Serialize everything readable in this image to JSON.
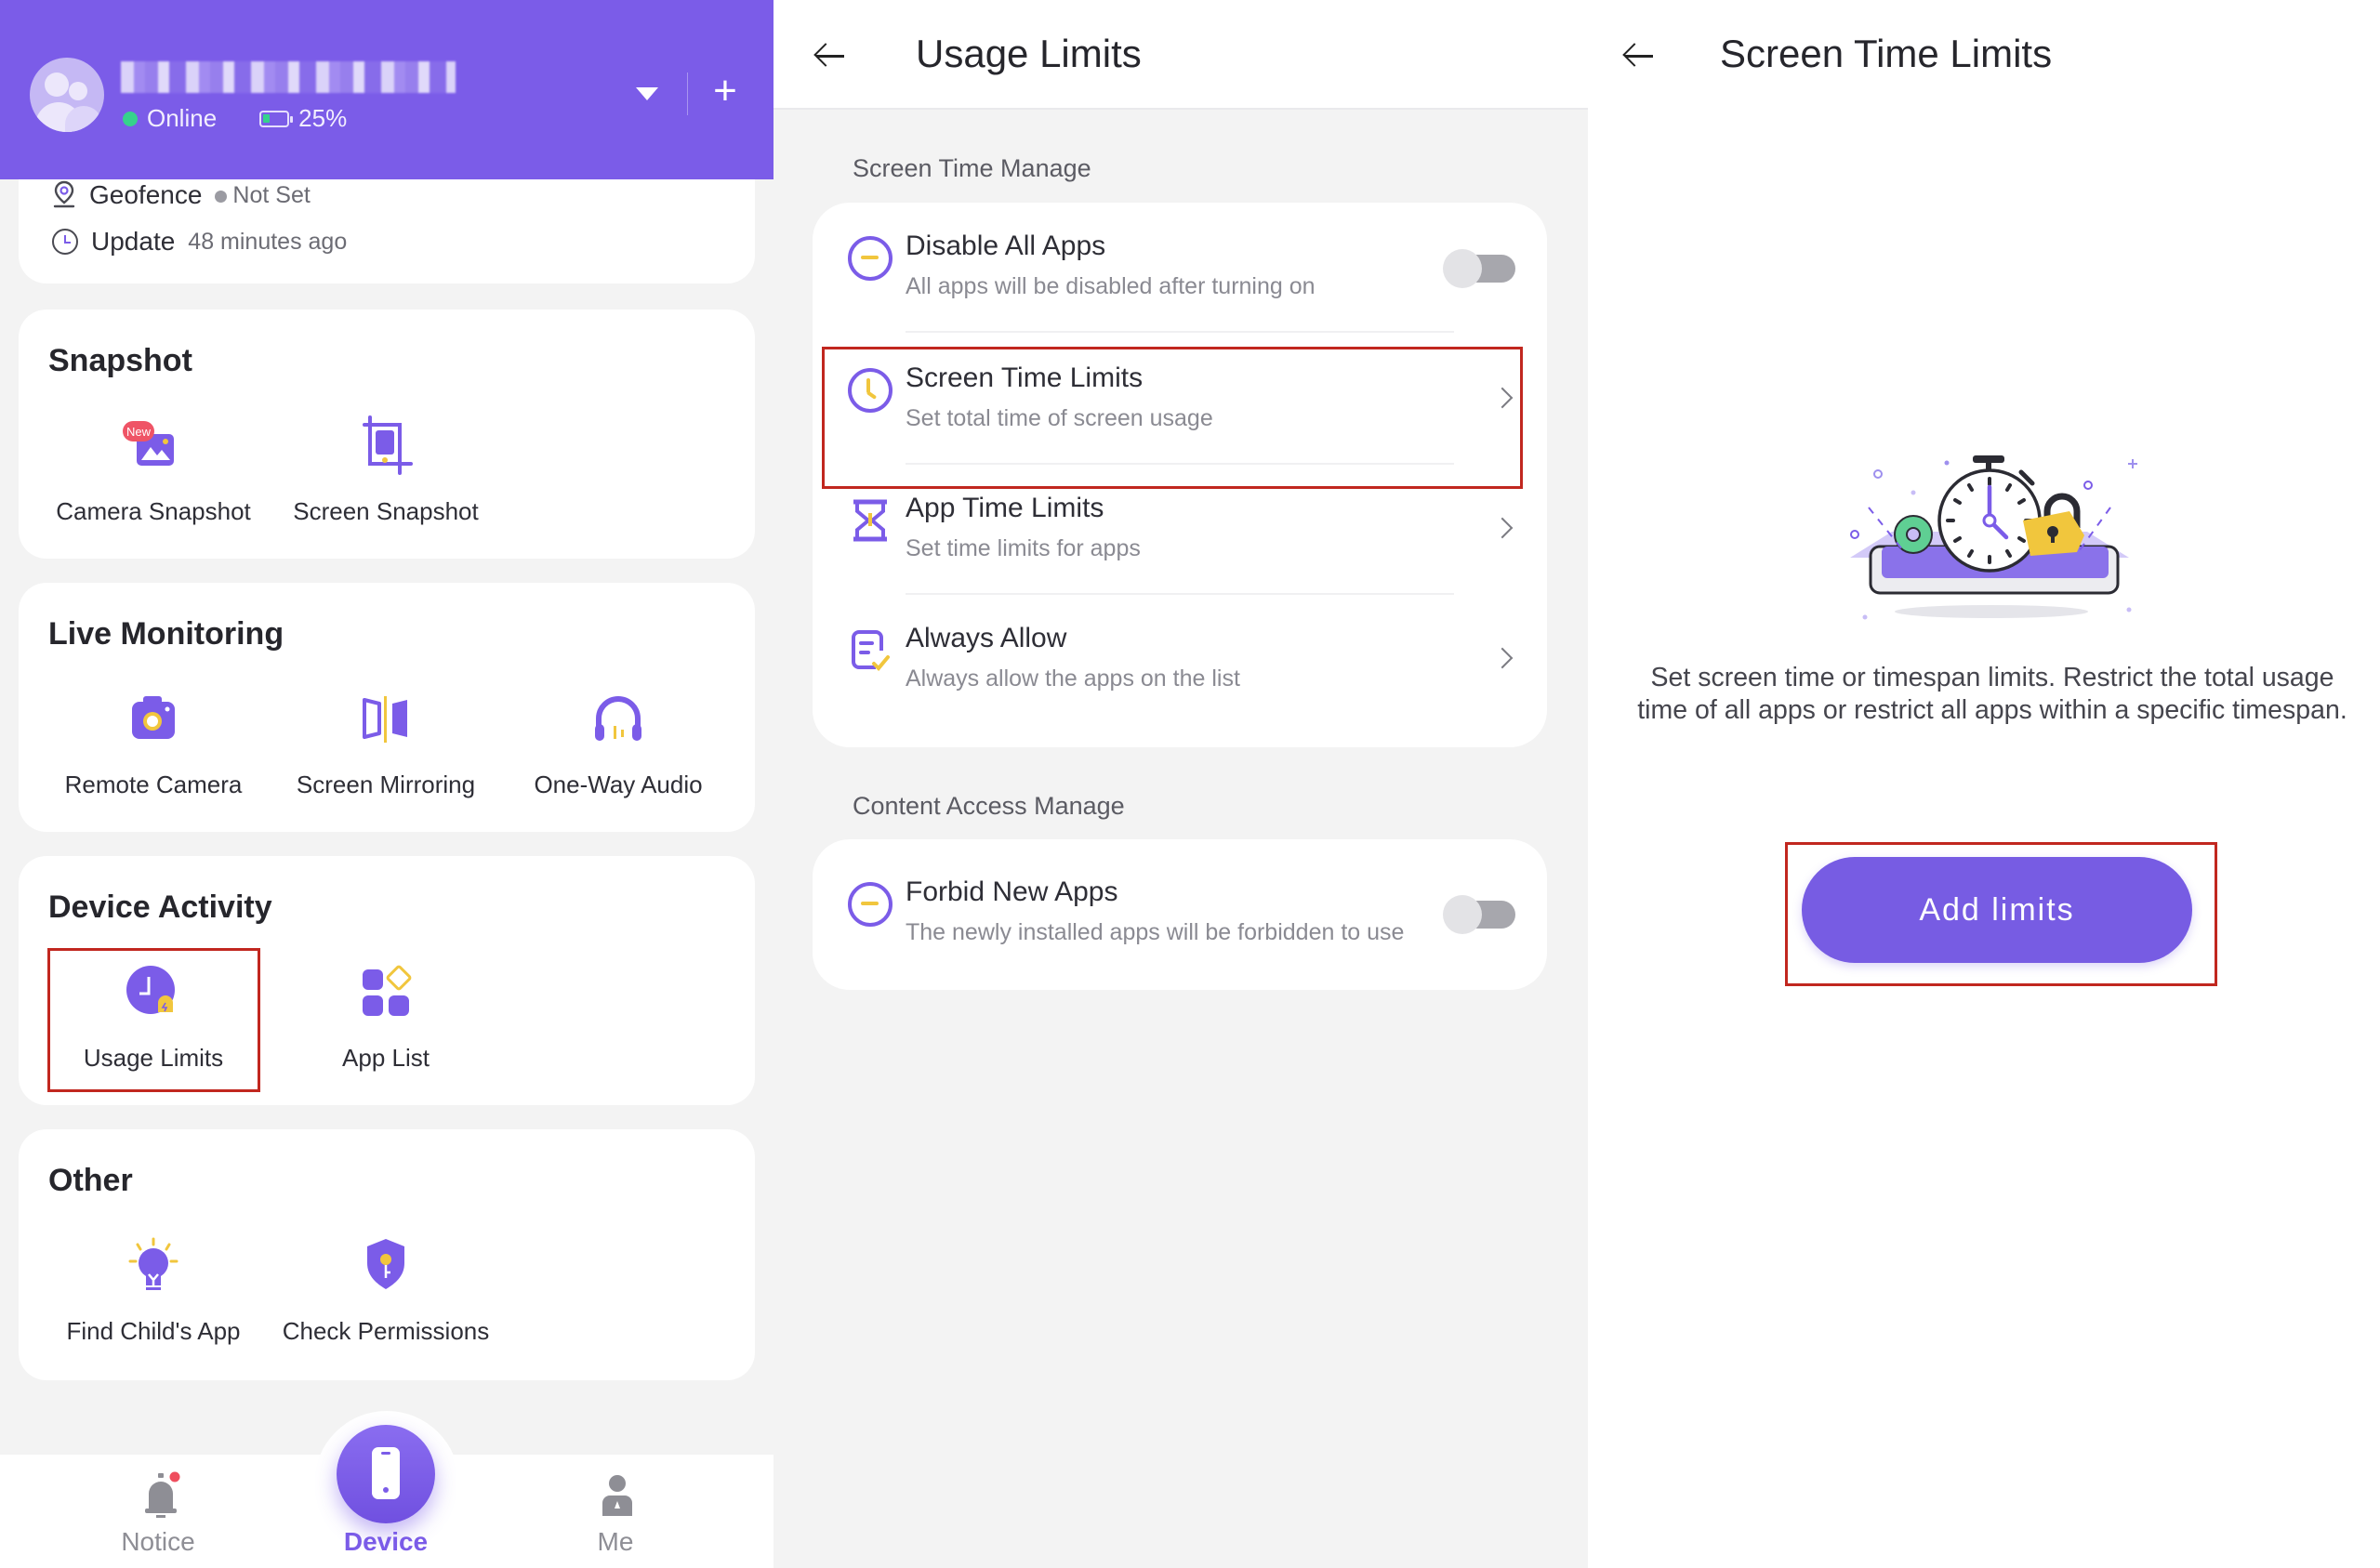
{
  "left_panel": {
    "header": {
      "device_name": "[redacted]",
      "status": "Online",
      "battery": "25%",
      "battery_level": 0.25,
      "dropdown_icon": "triangle-down-icon",
      "add_icon": "plus-icon"
    },
    "info": {
      "geofence_label": "Geofence",
      "geofence_value": "Not Set",
      "update_label": "Update",
      "update_value": "48 minutes ago"
    },
    "sections": [
      {
        "title": "Snapshot",
        "items": [
          {
            "label": "Camera Snapshot",
            "badge": "New",
            "icon": "image-icon"
          },
          {
            "label": "Screen Snapshot",
            "icon": "screenshot-crop-icon"
          }
        ]
      },
      {
        "title": "Live Monitoring",
        "items": [
          {
            "label": "Remote Camera",
            "icon": "camera-icon"
          },
          {
            "label": "Screen Mirroring",
            "icon": "mirror-icon"
          },
          {
            "label": "One-Way Audio",
            "icon": "headphones-icon"
          }
        ]
      },
      {
        "title": "Device Activity",
        "items": [
          {
            "label": "Usage Limits",
            "icon": "clock-lock-icon",
            "highlighted": true
          },
          {
            "label": "App List",
            "icon": "app-grid-icon"
          }
        ]
      },
      {
        "title": "Other",
        "items": [
          {
            "label": "Find Child's App",
            "icon": "lightbulb-icon"
          },
          {
            "label": "Check Permissions",
            "icon": "shield-key-icon"
          }
        ]
      }
    ],
    "bottom_nav": [
      {
        "label": "Notice",
        "icon": "bell-icon",
        "has_dot": true
      },
      {
        "label": "Device",
        "icon": "phone-icon",
        "active": true
      },
      {
        "label": "Me",
        "icon": "user-icon"
      }
    ]
  },
  "middle_panel": {
    "title": "Usage Limits",
    "back_icon": "arrow-left-icon",
    "section1_title": "Screen Time Manage",
    "section1_rows": [
      {
        "title": "Disable All Apps",
        "desc": "All apps will be disabled after turning on",
        "control": "toggle",
        "on": false
      },
      {
        "title": "Screen Time Limits",
        "desc": "Set total time of screen usage",
        "control": "chevron",
        "highlighted": true
      },
      {
        "title": "App Time Limits",
        "desc": "Set time limits for apps",
        "control": "chevron"
      },
      {
        "title": "Always Allow",
        "desc": "Always allow the apps on the list",
        "control": "chevron"
      }
    ],
    "section2_title": "Content Access Manage",
    "section2_rows": [
      {
        "title": "Forbid New Apps",
        "desc": "The newly installed apps will be forbidden to use",
        "control": "toggle",
        "on": false
      }
    ]
  },
  "right_panel": {
    "title": "Screen Time Limits",
    "back_icon": "arrow-left-icon",
    "illustration": "stopwatch-lock-phone-illustration",
    "description": "Set screen time or timespan limits. Restrict the total usage time of all apps or restrict all apps within a specific timespan.",
    "button_label": "Add limits",
    "button_highlighted": true
  },
  "colors": {
    "brand": "#7b5ce8",
    "accent_yellow": "#f1c63d",
    "highlight_box": "#c1271f",
    "online_green": "#36d28c"
  }
}
